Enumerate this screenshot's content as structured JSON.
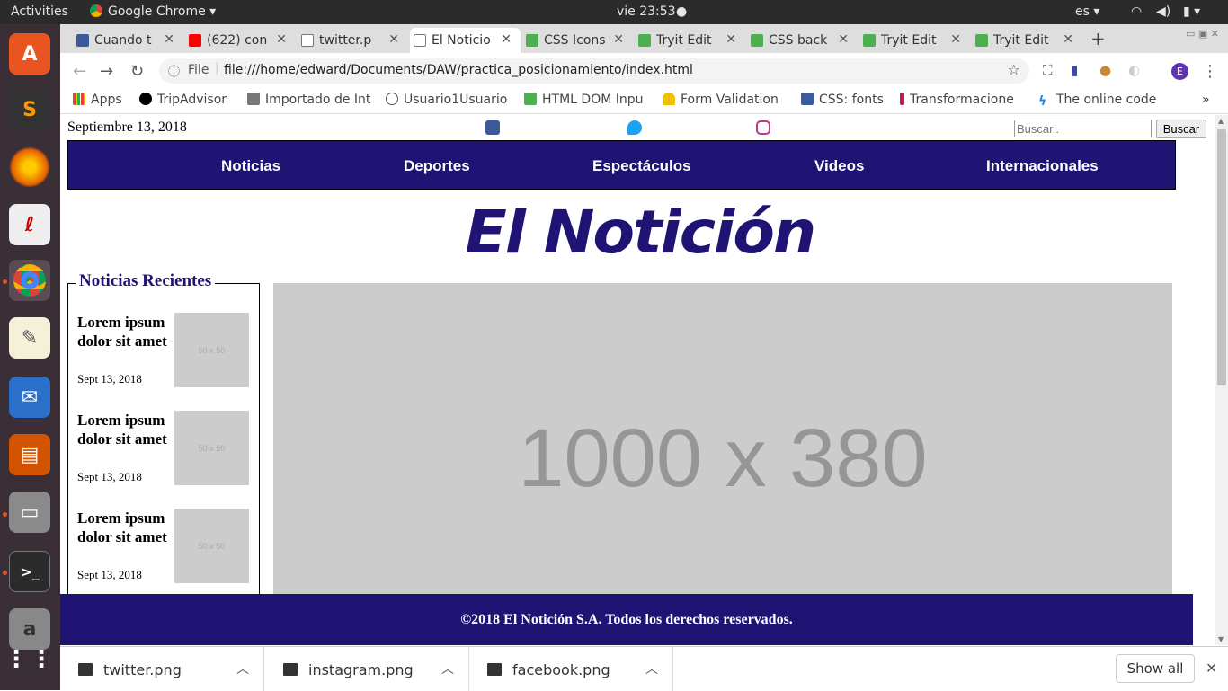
{
  "system": {
    "activities": "Activities",
    "app_menu": "Google Chrome",
    "clock": "vie 23:53",
    "keyboard": "es"
  },
  "tabs": [
    {
      "label": "Cuando t",
      "color": "#3b5998"
    },
    {
      "label": "(622) con",
      "color": "#ff0000"
    },
    {
      "label": "twitter.p",
      "color": "#999999"
    },
    {
      "label": "El Noticio",
      "color": "#999999",
      "active": true
    },
    {
      "label": "CSS Icons",
      "color": "#4caf50"
    },
    {
      "label": "Tryit Edit",
      "color": "#4caf50"
    },
    {
      "label": "CSS back",
      "color": "#4caf50"
    },
    {
      "label": "Tryit Edit",
      "color": "#4caf50"
    },
    {
      "label": "Tryit Edit",
      "color": "#4caf50"
    }
  ],
  "omnibox": {
    "scheme": "File",
    "url": "file:///home/edward/Documents/DAW/practica_posicionamiento/index.html"
  },
  "profile_initial": "E",
  "bookmarks": [
    {
      "label": "Apps",
      "color": "#e94235"
    },
    {
      "label": "TripAdvisor",
      "color": "#000000"
    },
    {
      "label": "Importado de Int",
      "color": "#777777"
    },
    {
      "label": "Usuario1Usuario",
      "color": "#555555"
    },
    {
      "label": "HTML DOM Inpu",
      "color": "#4caf50"
    },
    {
      "label": "Form Validation",
      "color": "#f0c000"
    },
    {
      "label": "CSS: fonts",
      "color": "#3a5ba0"
    },
    {
      "label": "Transformacione",
      "color": "#c2185b"
    },
    {
      "label": "The online code",
      "color": "#1e88e5"
    }
  ],
  "page": {
    "date": "Septiembre 13, 2018",
    "social": [
      {
        "name": "facebook",
        "color": "#3b5998"
      },
      {
        "name": "twitter",
        "color": "#1da1f2"
      },
      {
        "name": "instagram",
        "color": "#c13584"
      }
    ],
    "search": {
      "placeholder": "Buscar..",
      "button": "Buscar"
    },
    "nav": [
      "Noticias",
      "Deportes",
      "Espectáculos",
      "Videos",
      "Internacionales"
    ],
    "logo": "El Notición",
    "sidebar": {
      "title": "Noticias Recientes",
      "items": [
        {
          "title": "Lorem ipsum dolor sit amet",
          "date": "Sept 13, 2018",
          "thumb": "50 x 50"
        },
        {
          "title": "Lorem ipsum dolor sit amet",
          "date": "Sept 13, 2018",
          "thumb": "50 x 50"
        },
        {
          "title": "Lorem ipsum dolor sit amet",
          "date": "Sept 13, 2018",
          "thumb": "50 x 50"
        }
      ]
    },
    "hero": "1000 x 380",
    "footer": "©2018 El Notición S.A. Todos los derechos reservados."
  },
  "downloads": {
    "files": [
      "twitter.png",
      "instagram.png",
      "facebook.png"
    ],
    "show_all": "Show all"
  },
  "colors": {
    "brand": "#1f1473"
  }
}
